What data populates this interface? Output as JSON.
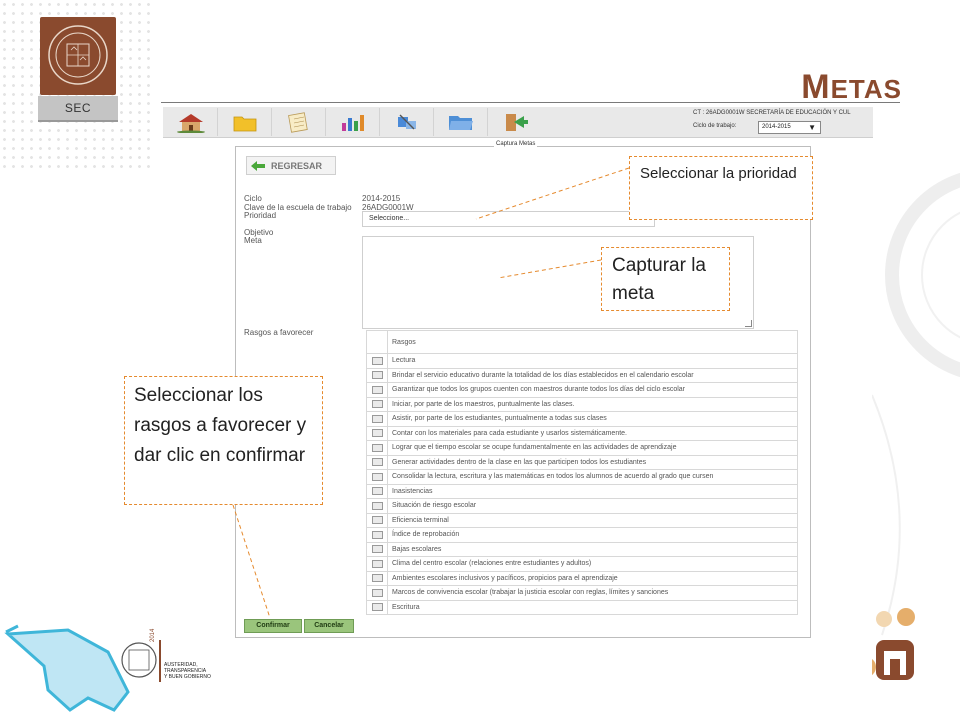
{
  "slide": {
    "title_first": "M",
    "title_rest": "ETAS",
    "logo_label": "SEC"
  },
  "toolbar": {
    "buttons": [
      "home-icon",
      "folder-icon",
      "notepad-icon",
      "chart-icon",
      "tools-icon",
      "folder-open-icon",
      "exit-icon"
    ],
    "school_info": "CT : 26ADG0001W SECRETARÍA DE EDUCACIÓN Y CUL",
    "ciclo_label": "Ciclo de trabajo:",
    "ciclo_value": "2014-2015"
  },
  "form": {
    "panel_title": "Captura Metas",
    "regresar": "REGRESAR",
    "ciclo_label": "Ciclo",
    "ciclo_value": "2014-2015",
    "clave_label": "Clave de la escuela de trabajo",
    "clave_value": "26ADG0001W",
    "prioridad_label": "Prioridad",
    "prioridad_placeholder": "Seleccione...",
    "objetivo_label": "Objetivo",
    "meta_label": "Meta",
    "rasgos_label": "Rasgos a favorecer",
    "table_header": "Rasgos",
    "rasgos": [
      "Lectura",
      "Brindar el servicio educativo durante la totalidad de los días establecidos en el calendario escolar",
      "Garantizar que todos los grupos cuenten con maestros durante todos los días del ciclo escolar",
      "Iniciar, por parte de los maestros, puntualmente las clases.",
      "Asistir, por parte de los estudiantes, puntualmente a todas sus clases",
      "Contar con los materiales para cada estudiante y usarlos sistemáticamente.",
      "Lograr que el tiempo escolar se ocupe fundamentalmente en las actividades de aprendizaje",
      "Generar actividades dentro de la clase en las que participen todos los estudiantes",
      "Consolidar la lectura, escritura y las matemáticas en todos los alumnos de acuerdo al grado que cursen",
      "Inasistencias",
      "Situación de riesgo escolar",
      "Eficiencia terminal",
      "Índice de reprobación",
      "Bajas escolares",
      "Clima del centro escolar (relaciones entre estudiantes y adultos)",
      "Ambientes escolares inclusivos y pacíficos, propicios para el aprendizaje",
      "Marcos de convivencia escolar (trabajar la justicia escolar con reglas, límites y sanciones",
      "Escritura"
    ],
    "confirmar": "Confirmar",
    "cancelar": "Cancelar"
  },
  "callouts": {
    "prioridad": "Seleccionar la prioridad",
    "meta": "Capturar la meta",
    "rasgos": "Seleccionar los rasgos a favorecer y dar clic en confirmar"
  },
  "footer": {
    "slogan_line1": "AUSTERIDAD, TRANSPARENCIA",
    "slogan_line2": "Y BUEN GOBIERNO",
    "year": "2014"
  },
  "colors": {
    "brand": "#8a4a2e",
    "callout_border": "#e58a2e",
    "button_green": "#9ac57c",
    "footer_cyan": "#3fb6d9"
  }
}
